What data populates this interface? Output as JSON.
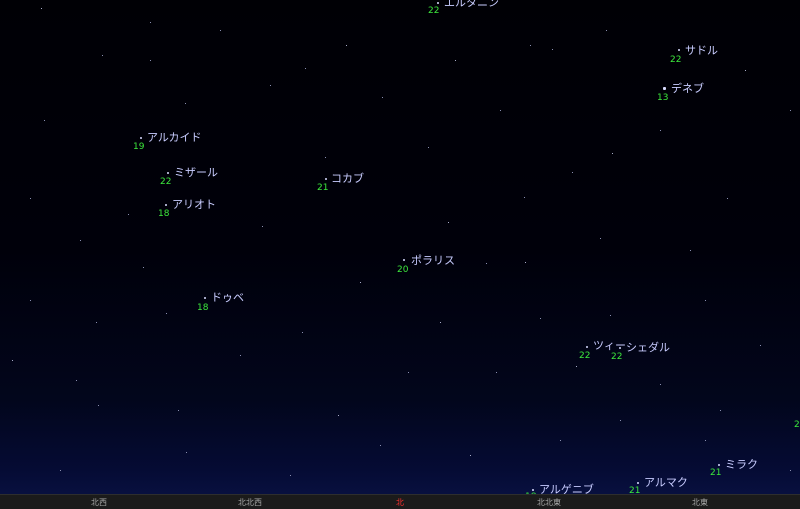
{
  "stars": [
    {
      "id": "eltanin",
      "name": "エルタニン",
      "mag": "22"
    },
    {
      "id": "sadr",
      "name": "サドル",
      "mag": "22"
    },
    {
      "id": "deneb",
      "name": "デネブ",
      "mag": "13"
    },
    {
      "id": "alkaid",
      "name": "アルカイド",
      "mag": "19"
    },
    {
      "id": "mizar",
      "name": "ミザール",
      "mag": "22"
    },
    {
      "id": "kochab",
      "name": "コカブ",
      "mag": "21"
    },
    {
      "id": "alioth",
      "name": "アリオト",
      "mag": "18"
    },
    {
      "id": "polaris",
      "name": "ポラリス",
      "mag": "20"
    },
    {
      "id": "dubhe",
      "name": "ドゥベ",
      "mag": "18"
    },
    {
      "id": "tsih",
      "name": "ツィー",
      "mag": "22"
    },
    {
      "id": "schedar",
      "name": "シェダル",
      "mag": "22"
    },
    {
      "id": "mirach",
      "name": "ミラク",
      "mag": "21"
    },
    {
      "id": "almach",
      "name": "アルマク",
      "mag": "21"
    },
    {
      "id": "algenib",
      "name": "アルゲニブ",
      "mag": "18"
    },
    {
      "id": "edge-right",
      "name": "",
      "mag": "2"
    }
  ],
  "compass": [
    {
      "label": "北西"
    },
    {
      "label": "北北西"
    },
    {
      "label": "北"
    },
    {
      "label": "北北東"
    },
    {
      "label": "北東"
    }
  ],
  "colors": {
    "name_label": "#c8ccff",
    "magnitude": "#3ce83c",
    "north_marker": "#ff3030",
    "compass_label": "#a8a8a8"
  }
}
